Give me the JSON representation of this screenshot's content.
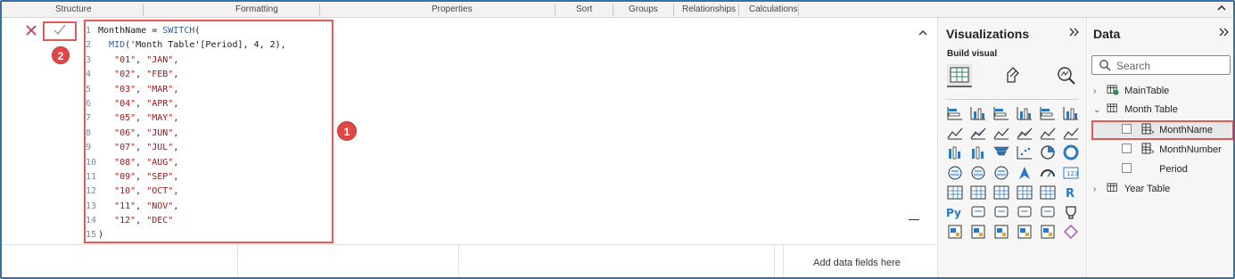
{
  "ribbon": {
    "groups": [
      "Structure",
      "Formatting",
      "Properties",
      "Sort",
      "Groups",
      "Relationships",
      "Calculations"
    ],
    "collapse_icon": "chevron-up-icon"
  },
  "formula_bar": {
    "cancel_icon": "close-icon",
    "commit_icon": "checkmark-icon",
    "badge_commit": "2",
    "badge_code": "1",
    "lines": [
      {
        "n": "1",
        "text": "MonthName = SWITCH("
      },
      {
        "n": "2",
        "text": "  MID('Month Table'[Period], 4, 2),"
      },
      {
        "n": "3",
        "text": "   \"01\", \"JAN\","
      },
      {
        "n": "4",
        "text": "   \"02\", \"FEB\","
      },
      {
        "n": "5",
        "text": "   \"03\", \"MAR\","
      },
      {
        "n": "6",
        "text": "   \"04\", \"APR\","
      },
      {
        "n": "7",
        "text": "   \"05\", \"MAY\","
      },
      {
        "n": "8",
        "text": "   \"06\", \"JUN\","
      },
      {
        "n": "9",
        "text": "   \"07\", \"JUL\","
      },
      {
        "n": "10",
        "text": "   \"08\", \"AUG\","
      },
      {
        "n": "11",
        "text": "   \"09\", \"SEP\","
      },
      {
        "n": "12",
        "text": "   \"10\", \"OCT\","
      },
      {
        "n": "13",
        "text": "   \"11\", \"NOV\","
      },
      {
        "n": "14",
        "text": "   \"12\", \"DEC\""
      },
      {
        "n": "15",
        "text": ")"
      }
    ]
  },
  "canvas": {
    "add_fields": "Add data fields here"
  },
  "visualizations": {
    "title": "Visualizations",
    "build_visual": "Build visual",
    "expand_icon": "double-chevron-right-icon"
  },
  "data": {
    "title": "Data",
    "expand_icon": "double-chevron-right-icon",
    "search_placeholder": "Search",
    "tree": {
      "main_table": "MainTable",
      "month_table": "Month Table",
      "month_name": "MonthName",
      "month_number": "MonthNumber",
      "period": "Period",
      "year_table": "Year Table"
    }
  },
  "colors": {
    "highlight": "#e15a5a",
    "badge": "#e04848",
    "accent": "#2f5eab",
    "string": "#a31515"
  }
}
